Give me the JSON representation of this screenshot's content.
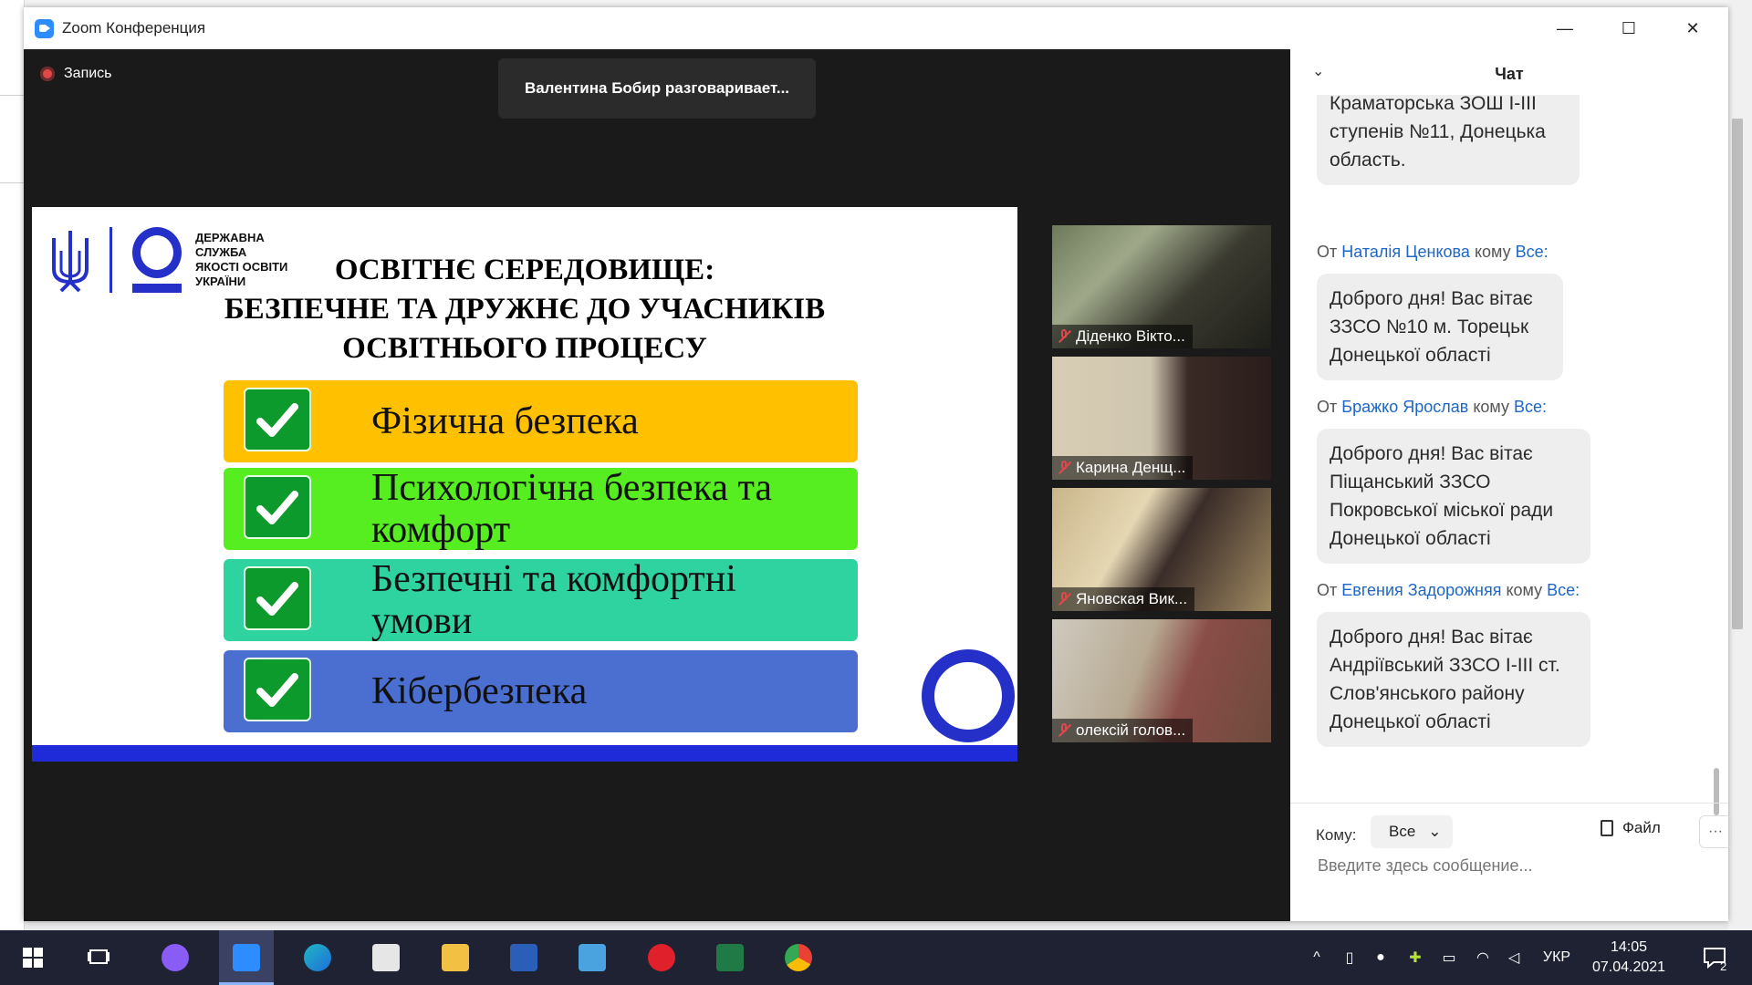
{
  "window": {
    "title": "Zoom Конференция",
    "minimize": "—",
    "maximize": "☐",
    "close": "✕"
  },
  "meeting": {
    "recording_label": "Запись",
    "talking_banner": "Валентина Бобир разговаривает...",
    "slide": {
      "agency": "ДЕРЖАВНА\nСЛУЖБА\nЯКОСТІ ОСВІТИ\nУКРАЇНИ",
      "title": "ОСВІТНЄ СЕРЕДОВИЩЕ:\nБЕЗПЕЧНЕ ТА ДРУЖНЄ ДО УЧАСНИКІВ\nОСВІТНЬОГО ПРОЦЕСУ",
      "items": [
        {
          "label": "Фізична безпека",
          "color": "#ffc000"
        },
        {
          "label": "Психологічна безпека та комфорт",
          "color": "#57ee21"
        },
        {
          "label": "Безпечні та комфортні умови",
          "color": "#2fd3a0"
        },
        {
          "label": "Кібербезпека",
          "color": "#4a6fd0"
        }
      ]
    },
    "participants": [
      {
        "name": "Діденко Вікто..."
      },
      {
        "name": "Карина Денщ..."
      },
      {
        "name": "Яновская Вик..."
      },
      {
        "name": "олексій голов..."
      }
    ]
  },
  "chat": {
    "title": "Чат",
    "collapse_icon": "⌄",
    "messages": [
      {
        "from_prefix": "",
        "from": "",
        "to_prefix": "",
        "to": "",
        "text": "Краматорська ЗОШ I-III\nступенів №11, Донецька\nобласть."
      },
      {
        "from_prefix": "От",
        "from": "Наталія Ценкова",
        "to_prefix": "кому",
        "to": "Все:",
        "text": "Доброго дня! Вас вітає\nЗЗСО №10 м. Торецьк\nДонецької області"
      },
      {
        "from_prefix": "От",
        "from": "Бражко Ярослав",
        "to_prefix": "кому",
        "to": "Все:",
        "text": "Доброго дня! Вас вітає\nПіщанський ЗЗСО\nПокровської міської ради\nДонецької області"
      },
      {
        "from_prefix": "От",
        "from": "Евгения Задорожняя",
        "to_prefix": "кому",
        "to": "Все:",
        "text": "Доброго дня! Вас вітає\nАндріївський ЗЗСО I-III ст.\nСлов'янського району\nДонецької області"
      }
    ],
    "to_label": "Кому:",
    "to_value": "Все",
    "file_label": "Файл",
    "more": "···",
    "input_placeholder": "Введите здесь сообщение..."
  },
  "taskbar": {
    "language": "УКР",
    "time": "14:05",
    "date": "07.04.2021",
    "notifications": "2"
  }
}
